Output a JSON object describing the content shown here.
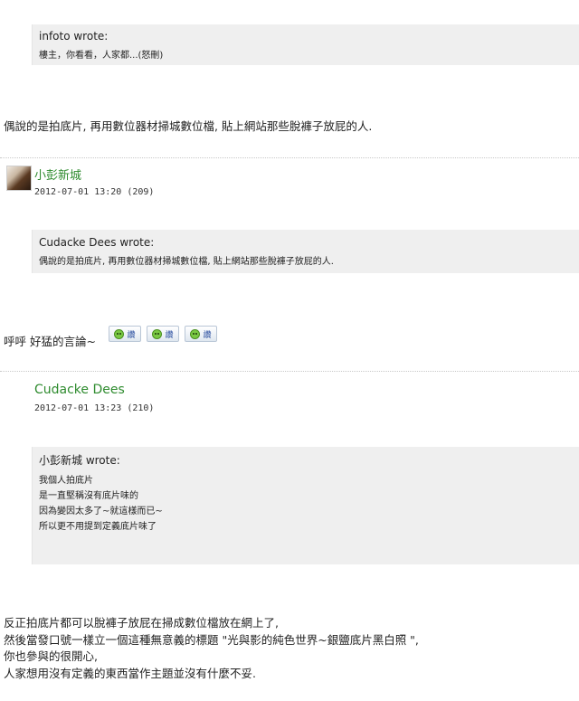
{
  "post1": {
    "quote": {
      "author": "infoto wrote:",
      "lines": [
        "樓主，你看看，人家都...(怒刪)"
      ]
    },
    "body": "偶說的是拍底片, 再用數位器材掃城數位檔, 貼上網站那些脫褲子放屁的人."
  },
  "post2": {
    "username": "小彭新城",
    "meta": "2012-07-01 13:20 (209)",
    "quote": {
      "author": "Cudacke Dees wrote:",
      "lines": [
        "偶說的是拍底片, 再用數位器材掃城數位檔, 貼上網站那些脫褲子放屁的人."
      ]
    },
    "body": "呼呼 好猛的言論~",
    "emoticons": [
      {
        "icon": "smiley-icon",
        "label": "讚"
      },
      {
        "icon": "smiley-icon",
        "label": "讚"
      },
      {
        "icon": "smiley-icon",
        "label": "讚"
      }
    ]
  },
  "post3": {
    "username": "Cudacke Dees",
    "meta": "2012-07-01 13:23 (210)",
    "quote": {
      "author": "小彭新城 wrote:",
      "lines": [
        "我個人拍底片",
        "是一直堅稱沒有底片味的",
        "因為變因太多了~就這樣而已~",
        "",
        "所以更不用提到定義底片味了"
      ]
    },
    "body_lines": [
      "反正拍底片都可以脫褲子放屁在掃成數位檔放在網上了,",
      "然後當發口號一樣立一個這種無意義的標題 \"光與影的純色世界~銀鹽底片黑白照 \",",
      "你也參與的很開心,",
      "人家想用沒有定義的東西當作主題並沒有什麼不妥."
    ]
  }
}
